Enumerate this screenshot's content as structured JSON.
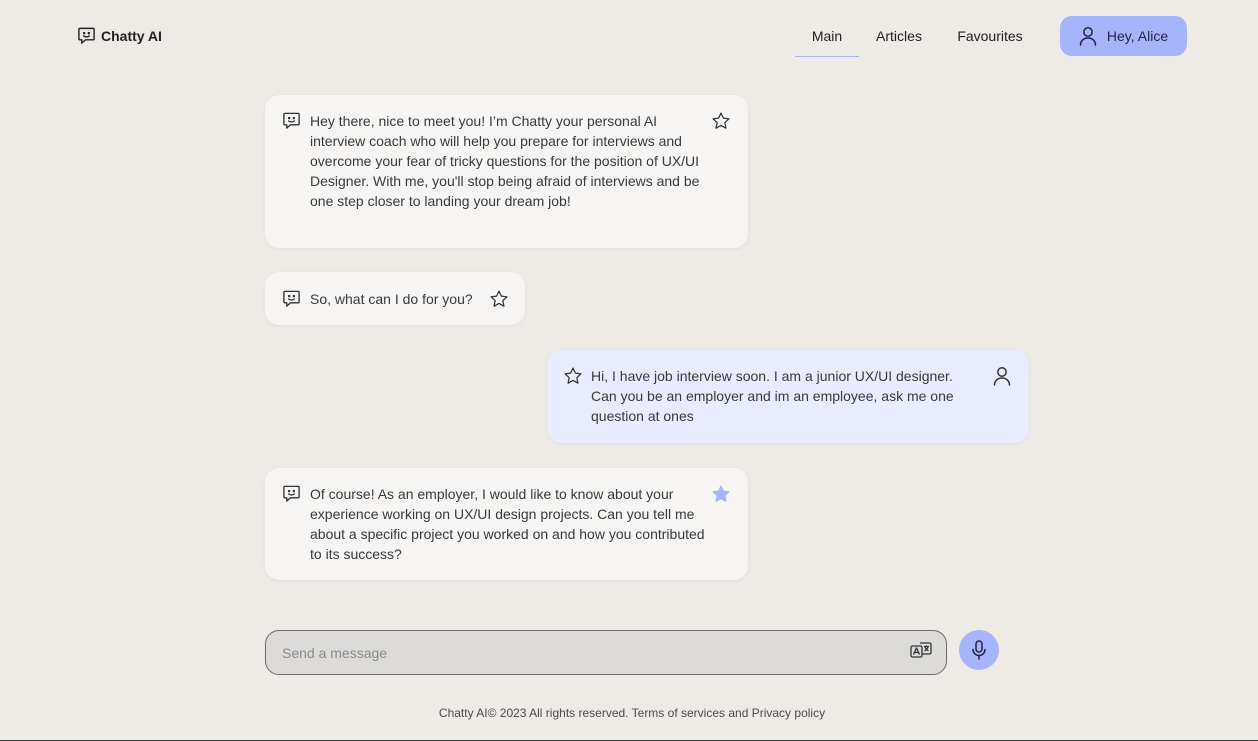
{
  "brand": {
    "name": "Chatty AI",
    "icon": "chat-bot-icon"
  },
  "nav": {
    "items": [
      {
        "label": "Main",
        "active": true
      },
      {
        "label": "Articles",
        "active": false
      },
      {
        "label": "Favourites",
        "active": false
      }
    ],
    "user_greeting": "Hey, Alice",
    "user_icon": "user-icon"
  },
  "messages": [
    {
      "sender": "bot",
      "text": "Hey there, nice to meet you! I’m Chatty your personal AI interview coach who will help you prepare for interviews and overcome your fear of tricky questions for the position of UX/UI Designer. With me, you'll stop being afraid of interviews and be one step closer to landing your dream job!",
      "favourite": false
    },
    {
      "sender": "bot",
      "text": "So, what can I do for you?",
      "favourite": false
    },
    {
      "sender": "user",
      "text": "Hi, I have job interview soon. I am a junior UX/UI designer. Can you be an employer and im an employee, ask me one question at ones",
      "favourite": false
    },
    {
      "sender": "bot",
      "text": "Of course! As an employer, I would like to know about your experience working on UX/UI design projects. Can you tell me about a specific project you worked on and how you contributed to its success?",
      "favourite": true
    }
  ],
  "composer": {
    "placeholder": "Send a message",
    "value": "",
    "translate_icon": "translate-icon",
    "mic_icon": "microphone-icon"
  },
  "footer": {
    "copyright": "Chatty AI© 2023 All rights reserved.",
    "terms_label": "Terms of services",
    "and_text": "and",
    "privacy_label": "Privacy policy"
  },
  "colors": {
    "background": "#eeebe7",
    "accent": "#a6b4fb",
    "bot_bubble": "#f6f5f4",
    "user_bubble": "#e9ebfe",
    "star_filled": "#a6b4fb"
  }
}
